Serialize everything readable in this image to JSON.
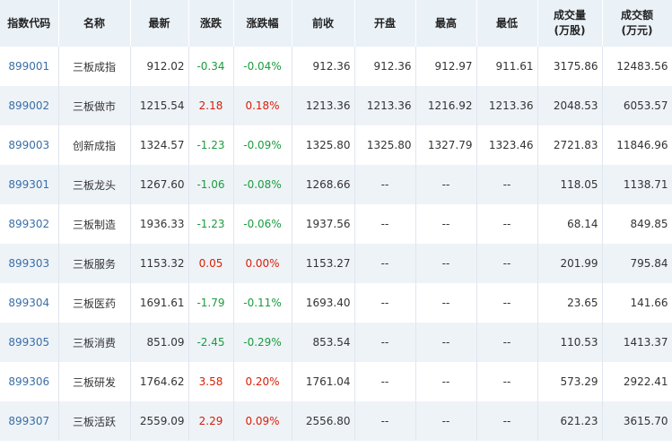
{
  "table": {
    "headers": [
      [
        "指数代码"
      ],
      [
        "名称"
      ],
      [
        "最新"
      ],
      [
        "涨跌"
      ],
      [
        "涨跌幅"
      ],
      [
        "前收"
      ],
      [
        "开盘"
      ],
      [
        "最高"
      ],
      [
        "最低"
      ],
      [
        "成交量",
        "(万股)"
      ],
      [
        "成交额",
        "(万元)"
      ]
    ],
    "rows": [
      {
        "code": "899001",
        "name": "三板成指",
        "last": "912.02",
        "change": "-0.34",
        "pct": "-0.04%",
        "prev": "912.36",
        "open": "912.36",
        "high": "912.97",
        "low": "911.61",
        "volume": "3175.86",
        "amount": "12483.56",
        "dir": "down"
      },
      {
        "code": "899002",
        "name": "三板做市",
        "last": "1215.54",
        "change": "2.18",
        "pct": "0.18%",
        "prev": "1213.36",
        "open": "1213.36",
        "high": "1216.92",
        "low": "1213.36",
        "volume": "2048.53",
        "amount": "6053.57",
        "dir": "up"
      },
      {
        "code": "899003",
        "name": "创新成指",
        "last": "1324.57",
        "change": "-1.23",
        "pct": "-0.09%",
        "prev": "1325.80",
        "open": "1325.80",
        "high": "1327.79",
        "low": "1323.46",
        "volume": "2721.83",
        "amount": "11846.96",
        "dir": "down"
      },
      {
        "code": "899301",
        "name": "三板龙头",
        "last": "1267.60",
        "change": "-1.06",
        "pct": "-0.08%",
        "prev": "1268.66",
        "open": "--",
        "high": "--",
        "low": "--",
        "volume": "118.05",
        "amount": "1138.71",
        "dir": "down"
      },
      {
        "code": "899302",
        "name": "三板制造",
        "last": "1936.33",
        "change": "-1.23",
        "pct": "-0.06%",
        "prev": "1937.56",
        "open": "--",
        "high": "--",
        "low": "--",
        "volume": "68.14",
        "amount": "849.85",
        "dir": "down"
      },
      {
        "code": "899303",
        "name": "三板服务",
        "last": "1153.32",
        "change": "0.05",
        "pct": "0.00%",
        "prev": "1153.27",
        "open": "--",
        "high": "--",
        "low": "--",
        "volume": "201.99",
        "amount": "795.84",
        "dir": "up"
      },
      {
        "code": "899304",
        "name": "三板医药",
        "last": "1691.61",
        "change": "-1.79",
        "pct": "-0.11%",
        "prev": "1693.40",
        "open": "--",
        "high": "--",
        "low": "--",
        "volume": "23.65",
        "amount": "141.66",
        "dir": "down"
      },
      {
        "code": "899305",
        "name": "三板消费",
        "last": "851.09",
        "change": "-2.45",
        "pct": "-0.29%",
        "prev": "853.54",
        "open": "--",
        "high": "--",
        "low": "--",
        "volume": "110.53",
        "amount": "1413.37",
        "dir": "down"
      },
      {
        "code": "899306",
        "name": "三板研发",
        "last": "1764.62",
        "change": "3.58",
        "pct": "0.20%",
        "prev": "1761.04",
        "open": "--",
        "high": "--",
        "low": "--",
        "volume": "573.29",
        "amount": "2922.41",
        "dir": "up"
      },
      {
        "code": "899307",
        "name": "三板活跃",
        "last": "2559.09",
        "change": "2.29",
        "pct": "0.09%",
        "prev": "2556.80",
        "open": "--",
        "high": "--",
        "low": "--",
        "volume": "621.23",
        "amount": "3615.70",
        "dir": "up"
      }
    ]
  },
  "colors": {
    "up": "#d81e06",
    "down": "#1a9c3e",
    "code_link": "#3a6ea5",
    "header_bg": "#eaf1f7",
    "stripe_bg": "#eef3f8"
  }
}
